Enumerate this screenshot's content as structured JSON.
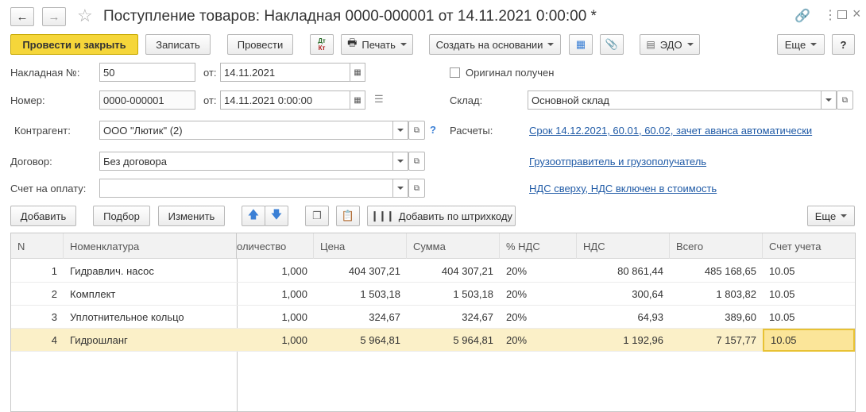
{
  "window": {
    "title": "Поступление товаров: Накладная 0000-000001 от 14.11.2021 0:00:00 *"
  },
  "toolbar": {
    "post_close": "Провести и закрыть",
    "save": "Записать",
    "post": "Провести",
    "dtkt_dt": "Дт",
    "dtkt_kt": "Кт",
    "print": "Печать",
    "create_based": "Создать на основании",
    "edo": "ЭДО",
    "more": "Еще",
    "help": "?"
  },
  "form": {
    "invoice_no_label": "Накладная №:",
    "invoice_no": "50",
    "from_label": "от:",
    "invoice_date": "14.11.2021",
    "original_label": "Оригинал получен",
    "number_label": "Номер:",
    "number": "0000-000001",
    "number_date": "14.11.2021  0:00:00",
    "warehouse_label": "Склад:",
    "warehouse": "Основной склад",
    "counterparty_label": "Контрагент:",
    "counterparty": "ООО \"Лютик\" (2)",
    "counterparty_help": "?",
    "settlements_label": "Расчеты:",
    "settlements_link": "Срок 14.12.2021, 60.01, 60.02, зачет аванса автоматически",
    "contract_label": "Договор:",
    "contract": "Без договора",
    "shipper_link": "Грузоотправитель и грузополучатель",
    "payment_invoice_label": "Счет на оплату:",
    "payment_invoice": "",
    "vat_link": "НДС сверху, НДС включен в стоимость"
  },
  "table_toolbar": {
    "add": "Добавить",
    "pick": "Подбор",
    "edit": "Изменить",
    "barcode": "Добавить по штрихкоду",
    "more": "Еще"
  },
  "table": {
    "headers": {
      "n": "N",
      "item": "Номенклатура",
      "qty": "оличество",
      "price": "Цена",
      "sum": "Сумма",
      "vat_rate": "% НДС",
      "vat": "НДС",
      "total": "Всего",
      "account": "Счет учета"
    },
    "rows": [
      {
        "n": "1",
        "item": "Гидравлич. насос",
        "qty": "1,000",
        "price": "404 307,21",
        "sum": "404 307,21",
        "vat_rate": "20%",
        "vat": "80 861,44",
        "total": "485 168,65",
        "account": "10.05"
      },
      {
        "n": "2",
        "item": "Комплект",
        "qty": "1,000",
        "price": "1 503,18",
        "sum": "1 503,18",
        "vat_rate": "20%",
        "vat": "300,64",
        "total": "1 803,82",
        "account": "10.05"
      },
      {
        "n": "3",
        "item": "Уплотнительное кольцо",
        "qty": "1,000",
        "price": "324,67",
        "sum": "324,67",
        "vat_rate": "20%",
        "vat": "64,93",
        "total": "389,60",
        "account": "10.05"
      },
      {
        "n": "4",
        "item": "Гидрошланг",
        "qty": "1,000",
        "price": "5 964,81",
        "sum": "5 964,81",
        "vat_rate": "20%",
        "vat": "1 192,96",
        "total": "7 157,77",
        "account": "10.05"
      }
    ]
  },
  "colors": {
    "primary_button": "#f5d63a",
    "link": "#1f5aa6",
    "selected_row": "#fbf0c8",
    "arrow_blue": "#3a7fd5"
  }
}
